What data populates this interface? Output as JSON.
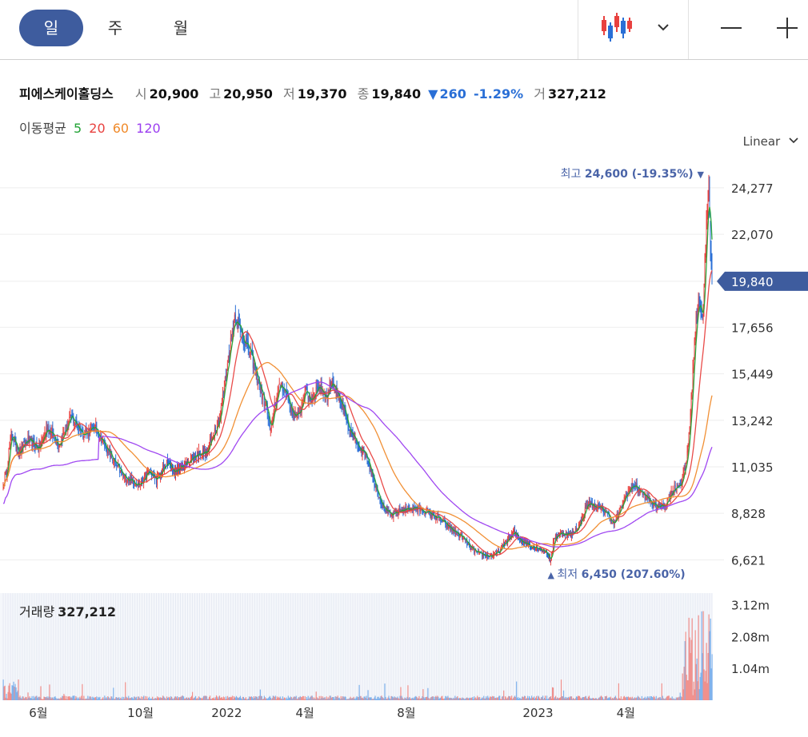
{
  "periods": [
    {
      "label": "일",
      "active": true
    },
    {
      "label": "주",
      "active": false
    },
    {
      "label": "월",
      "active": false
    }
  ],
  "toolbar": {
    "chart_type_icon": "candlestick-icon",
    "dropdown_icon": "chevron-down-icon",
    "zoom_out_icon": "minus-icon",
    "zoom_in_icon": "plus-icon"
  },
  "quote": {
    "name": "피에스케이홀딩스",
    "open_label": "시",
    "open": "20,900",
    "high_label": "고",
    "high": "20,950",
    "low_label": "저",
    "low": "19,370",
    "close_label": "종",
    "close": "19,840",
    "change_arrow": "▼",
    "change": "260",
    "change_pct": "-1.29%",
    "volume_label": "거",
    "volume": "327,212"
  },
  "ma_legend": {
    "label": "이동평균",
    "items": [
      {
        "label": "5",
        "color": "#22a336"
      },
      {
        "label": "20",
        "color": "#e8413f"
      },
      {
        "label": "60",
        "color": "#f08a2a"
      },
      {
        "label": "120",
        "color": "#9b3ef0"
      }
    ]
  },
  "scale_mode": "Linear",
  "colors": {
    "up": "#e8413f",
    "down": "#2a6fd6",
    "volume_up": "#f08f8b",
    "volume_down": "#7fb2ec",
    "current_price_tag": "#3e5c9e",
    "marker": "#4a64a8"
  },
  "chart_data": {
    "type": "candlestick",
    "y_axis_ticks": [
      "24,277",
      "22,070",
      "19,840",
      "17,656",
      "15,449",
      "13,242",
      "11,035",
      "8,828",
      "6,621"
    ],
    "ylim": [
      5800,
      25600
    ],
    "x_axis_ticks": [
      "6월",
      "10월",
      "2022",
      "4월",
      "8월",
      "2023",
      "4월"
    ],
    "current_price": "19,840",
    "high_marker": {
      "label": "최고",
      "value": "24,600",
      "pct": "(-19.35%)",
      "arrow": "▼"
    },
    "low_marker": {
      "label": "최저",
      "value": "6,450",
      "pct": "(207.60%)",
      "arrow": "▲"
    },
    "close_anchors": [
      [
        0,
        10100
      ],
      [
        4,
        10800
      ],
      [
        10,
        12600
      ],
      [
        20,
        11700
      ],
      [
        30,
        12300
      ],
      [
        45,
        11900
      ],
      [
        55,
        12900
      ],
      [
        70,
        12100
      ],
      [
        85,
        13400
      ],
      [
        100,
        12600
      ],
      [
        115,
        12900
      ],
      [
        125,
        12200
      ],
      [
        140,
        11200
      ],
      [
        150,
        10600
      ],
      [
        160,
        10400
      ],
      [
        172,
        10200
      ],
      [
        182,
        10800
      ],
      [
        192,
        10400
      ],
      [
        205,
        11200
      ],
      [
        215,
        10800
      ],
      [
        232,
        11300
      ],
      [
        245,
        11700
      ],
      [
        255,
        11700
      ],
      [
        265,
        12800
      ],
      [
        272,
        13500
      ],
      [
        282,
        16200
      ],
      [
        290,
        18200
      ],
      [
        300,
        17200
      ],
      [
        310,
        16400
      ],
      [
        320,
        15000
      ],
      [
        330,
        13800
      ],
      [
        335,
        12600
      ],
      [
        340,
        14000
      ],
      [
        348,
        15000
      ],
      [
        355,
        14500
      ],
      [
        362,
        13600
      ],
      [
        370,
        13400
      ],
      [
        378,
        14700
      ],
      [
        385,
        14200
      ],
      [
        395,
        14900
      ],
      [
        405,
        14300
      ],
      [
        412,
        15200
      ],
      [
        418,
        14400
      ],
      [
        425,
        13900
      ],
      [
        432,
        12900
      ],
      [
        440,
        12300
      ],
      [
        455,
        11600
      ],
      [
        465,
        10300
      ],
      [
        475,
        9200
      ],
      [
        485,
        8700
      ],
      [
        500,
        9000
      ],
      [
        515,
        9100
      ],
      [
        530,
        8900
      ],
      [
        545,
        8600
      ],
      [
        560,
        8100
      ],
      [
        575,
        7700
      ],
      [
        585,
        7200
      ],
      [
        595,
        6900
      ],
      [
        610,
        6800
      ],
      [
        620,
        6950
      ],
      [
        630,
        7500
      ],
      [
        640,
        7900
      ],
      [
        650,
        7500
      ],
      [
        660,
        7300
      ],
      [
        670,
        7200
      ],
      [
        680,
        7000
      ],
      [
        686,
        6550
      ],
      [
        690,
        7700
      ],
      [
        700,
        7900
      ],
      [
        712,
        7800
      ],
      [
        722,
        8300
      ],
      [
        732,
        9300
      ],
      [
        745,
        9100
      ],
      [
        755,
        8900
      ],
      [
        765,
        8300
      ],
      [
        772,
        8900
      ],
      [
        780,
        9700
      ],
      [
        790,
        10200
      ],
      [
        800,
        9800
      ],
      [
        810,
        9400
      ],
      [
        820,
        9100
      ],
      [
        830,
        9300
      ],
      [
        840,
        10000
      ],
      [
        850,
        10300
      ],
      [
        856,
        11300
      ],
      [
        861,
        13500
      ],
      [
        866,
        17000
      ],
      [
        871,
        19200
      ],
      [
        876,
        17900
      ],
      [
        881,
        22500
      ],
      [
        884,
        24100
      ],
      [
        886,
        21500
      ],
      [
        888,
        19840
      ]
    ],
    "volume_ticks": [
      "3.12m",
      "2.08m",
      "1.04m"
    ],
    "volume": {
      "label": "거래량",
      "value": "327,212",
      "max": "3.50m"
    }
  }
}
